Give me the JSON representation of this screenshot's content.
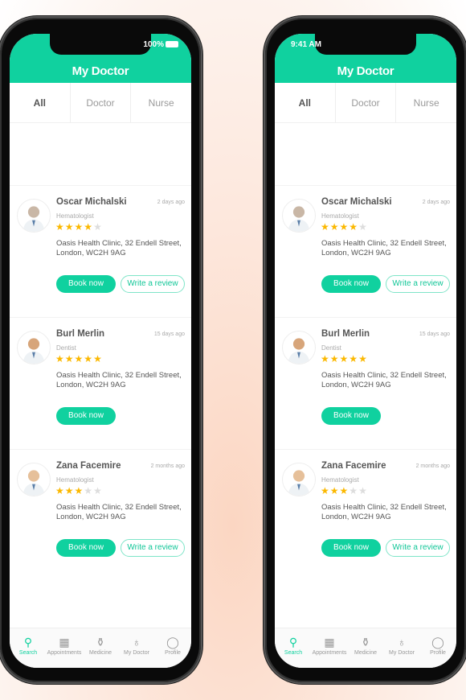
{
  "app": {
    "title": "My Doctor",
    "accent": "#10d19f"
  },
  "status": {
    "time": "9:41 AM",
    "battery": "100%"
  },
  "tabs": [
    {
      "label": "All"
    },
    {
      "label": "Doctor"
    },
    {
      "label": "Nurse"
    }
  ],
  "doctors": [
    {
      "name": "Oscar Michalski",
      "specialty": "Hematologist",
      "rating": 4,
      "date": "2 days ago",
      "address": "Oasis Health Clinic, 32 Endell Street, London, WC2H 9AG",
      "book": "Book now",
      "review": "Write a review",
      "has_review": true
    },
    {
      "name": "Burl Merlin",
      "specialty": "Dentist",
      "rating": 5,
      "date": "15 days ago",
      "address": "Oasis Health Clinic, 32 Endell Street, London, WC2H 9AG",
      "book": "Book now",
      "has_review": false
    },
    {
      "name": "Zana Facemire",
      "specialty": "Hematologist",
      "rating": 3,
      "date": "2 months ago",
      "address": "Oasis Health Clinic, 32 Endell Street, London, WC2H 9AG",
      "book": "Book now",
      "review": "Write a review",
      "has_review": true
    }
  ],
  "bottom_nav": [
    {
      "label": "Search",
      "icon": "search-icon"
    },
    {
      "label": "Appointments",
      "icon": "calendar-icon"
    },
    {
      "label": "Medicine",
      "icon": "medicine-icon"
    },
    {
      "label": "My Doctor",
      "icon": "stethoscope-icon"
    },
    {
      "label": "Profile",
      "icon": "profile-icon"
    }
  ]
}
